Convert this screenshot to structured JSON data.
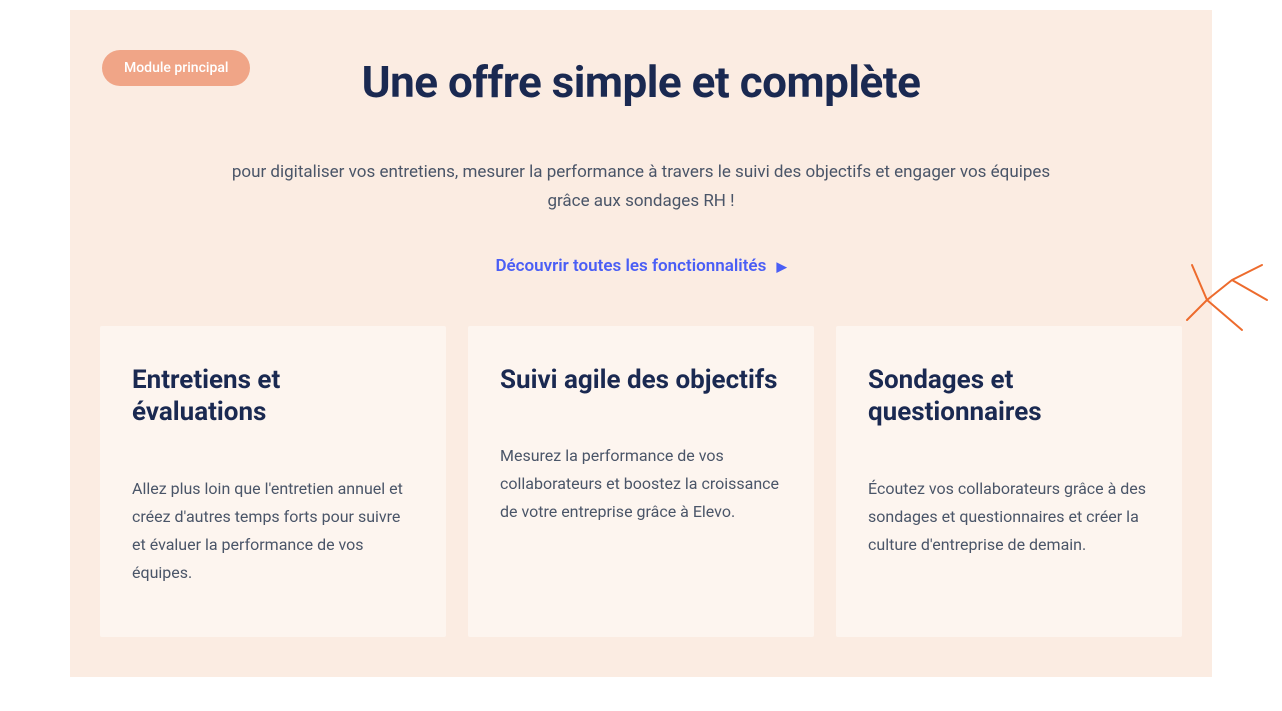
{
  "badge": "Module principal",
  "heading": "Une offre simple et complète",
  "subtext": "pour digitaliser vos entretiens, mesurer la performance à travers le suivi des objectifs et engager vos équipes grâce aux sondages RH !",
  "cta": "Découvrir toutes les fonctionnalités",
  "cards": [
    {
      "title": "Entretiens et évaluations",
      "text": "Allez plus loin que l'entretien annuel et créez d'autres temps forts pour suivre et évaluer la performance de vos équipes."
    },
    {
      "title": "Suivi agile des objectifs",
      "text": "Mesurez la performance de vos collaborateurs et boostez la croissance de votre entreprise grâce à Elevo."
    },
    {
      "title": "Sondages et questionnaires",
      "text": "Écoutez vos collaborateurs grâce à des sondages et questionnaires et créer la culture d'entreprise de demain."
    }
  ]
}
